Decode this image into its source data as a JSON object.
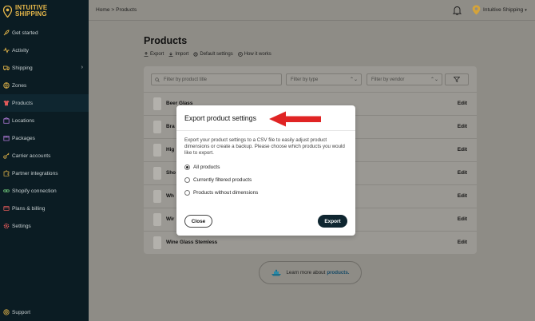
{
  "brand": {
    "line1": "INTUITIVE",
    "line2": "SHIPPING",
    "color": "#e7b84a"
  },
  "sidebar": {
    "items": [
      {
        "label": "Get started",
        "icon": "rocket-icon"
      },
      {
        "label": "Activity",
        "icon": "activity-icon"
      },
      {
        "label": "Shipping",
        "icon": "truck-icon",
        "has_chevron": true
      },
      {
        "label": "Zones",
        "icon": "globe-icon"
      },
      {
        "label": "Products",
        "icon": "shirt-icon",
        "active": true
      },
      {
        "label": "Locations",
        "icon": "building-icon"
      },
      {
        "label": "Packages",
        "icon": "box-icon"
      },
      {
        "label": "Carrier accounts",
        "icon": "key-icon"
      },
      {
        "label": "Partner integrations",
        "icon": "puzzle-icon"
      },
      {
        "label": "Shopify connection",
        "icon": "link-icon"
      },
      {
        "label": "Plans & billing",
        "icon": "billing-icon"
      },
      {
        "label": "Settings",
        "icon": "gear-icon"
      }
    ],
    "support_label": "Support",
    "chevron": "›"
  },
  "topbar": {
    "breadcrumb": "Home > Products",
    "account_name": "Intuitive Shipping",
    "account_caret": "▾"
  },
  "page": {
    "title": "Products",
    "actions": {
      "export": "Export",
      "import": "Import",
      "default_settings": "Default settings",
      "how_it_works": "How it works"
    }
  },
  "filters": {
    "title_placeholder": "Filter by product title",
    "type_placeholder": "Filter by type",
    "vendor_placeholder": "Filter by vendor",
    "caret": "⌃⌄"
  },
  "products": {
    "edit_label": "Edit",
    "rows": [
      {
        "name": "Beer Glass"
      },
      {
        "name": "Bra"
      },
      {
        "name": "Hig"
      },
      {
        "name": "Sho"
      },
      {
        "name": "Wh"
      },
      {
        "name": "Wir"
      },
      {
        "name": "Wine Glass Stemless"
      }
    ]
  },
  "learn_more": {
    "text": "Learn more about",
    "link": "products."
  },
  "modal": {
    "title": "Export product settings",
    "description": "Export your product settings to a CSV file to easily adjust product dimensions or create a backup. Please choose which products you would like to export.",
    "options": [
      {
        "label": "All products",
        "checked": true
      },
      {
        "label": "Currently filtered products",
        "checked": false
      },
      {
        "label": "Products without dimensions",
        "checked": false
      }
    ],
    "close_label": "Close",
    "export_label": "Export"
  },
  "colors": {
    "sidebar_bg": "#0b1c23",
    "primary_button": "#0f2630",
    "annotation_arrow": "#e02424"
  }
}
